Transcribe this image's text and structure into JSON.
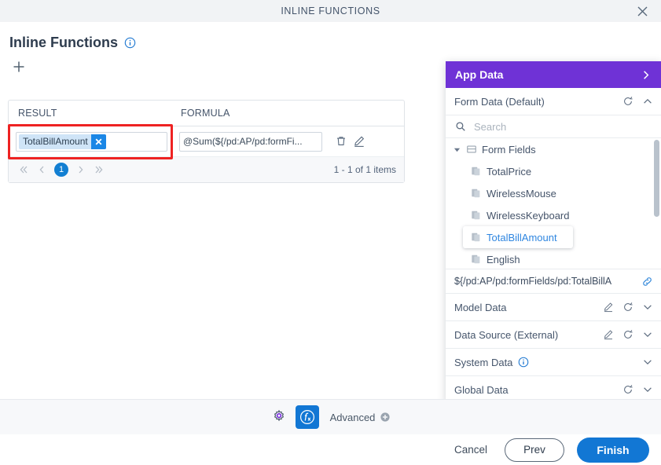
{
  "window": {
    "title": "INLINE FUNCTIONS",
    "close_icon": "close-icon"
  },
  "page": {
    "heading": "Inline Functions",
    "info_icon": "info-icon",
    "add_icon": "plus-icon"
  },
  "grid": {
    "columns": [
      "RESULT",
      "FORMULA"
    ],
    "rows": [
      {
        "result_chip": "TotalBillAmount",
        "chip_remove_icon": "close-icon",
        "formula": "@Sum(${/pd:AP/pd:formFi...",
        "delete_icon": "trash-icon",
        "edit_icon": "pencil-icon"
      }
    ],
    "pager": {
      "first_icon": "double-chevron-left-icon",
      "prev_icon": "chevron-left-icon",
      "current_page": "1",
      "next_icon": "chevron-right-icon",
      "last_icon": "double-chevron-right-icon"
    },
    "items_count": "1 - 1 of 1 items"
  },
  "right_panel": {
    "app_data": {
      "title": "App Data",
      "expand_icon": "chevron-right-icon",
      "accent_color": "#6f32d6"
    },
    "form_data": {
      "title": "Form Data (Default)",
      "refresh_icon": "refresh-icon",
      "collapse_icon": "chevron-up-icon"
    },
    "search": {
      "icon": "search-icon",
      "placeholder": "Search",
      "value": ""
    },
    "tree": {
      "root": {
        "label": "Form Fields",
        "caret_icon": "caret-down-icon",
        "icon": "folder-fields-icon"
      },
      "children": [
        {
          "label": "TotalPrice",
          "icon": "field-icon",
          "selected": false
        },
        {
          "label": "WirelessMouse",
          "icon": "field-icon",
          "selected": false
        },
        {
          "label": "WirelessKeyboard",
          "icon": "field-icon",
          "selected": false
        },
        {
          "label": "TotalBillAmount",
          "icon": "field-icon",
          "selected": true
        },
        {
          "label": "English",
          "icon": "field-icon",
          "selected": false
        }
      ]
    },
    "path": {
      "value": "${/pd:AP/pd:formFields/pd:TotalBillA",
      "link_icon": "link-icon"
    },
    "sections": [
      {
        "label": "Model Data",
        "has_info": false,
        "has_edit": true,
        "has_refresh": true,
        "chevron_icon": "chevron-down-icon"
      },
      {
        "label": "Data Source (External)",
        "has_info": false,
        "has_edit": true,
        "has_refresh": true,
        "chevron_icon": "chevron-down-icon"
      },
      {
        "label": "System Data",
        "has_info": true,
        "has_edit": false,
        "has_refresh": false,
        "chevron_icon": "chevron-down-icon"
      },
      {
        "label": "Global Data",
        "has_info": false,
        "has_edit": false,
        "has_refresh": true,
        "chevron_icon": "chevron-down-icon"
      }
    ]
  },
  "toolbar": {
    "gear_icon": "gear-icon",
    "fx_icon": "function-icon",
    "advanced_label": "Advanced",
    "advanced_plus_icon": "plus-circle-icon"
  },
  "footer": {
    "cancel_label": "Cancel",
    "prev_label": "Prev",
    "finish_label": "Finish"
  }
}
